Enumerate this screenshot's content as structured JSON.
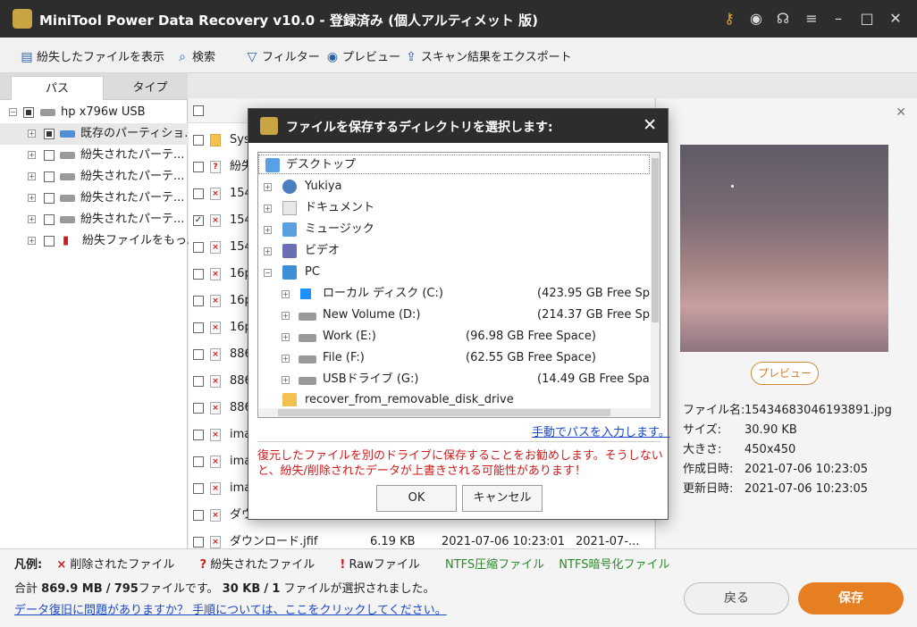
{
  "window": {
    "title": "MiniTool Power Data Recovery v10.0 - 登録済み (個人アルティメット 版)"
  },
  "toolbar": {
    "show_lost": "紛失したファイルを表示",
    "search": "検索",
    "filter": "フィルター",
    "preview": "プレビュー",
    "export": "スキャン結果をエクスポート"
  },
  "tabs": {
    "path": "パス",
    "type": "タイプ"
  },
  "tree": {
    "root": "hp x796w USB",
    "items": [
      "既存のパーティショ...",
      "紛失されたパーテ...",
      "紛失されたパーテ...",
      "紛失されたパーテ...",
      "紛失されたパーテ...",
      "紛失ファイルをもっ..."
    ]
  },
  "files": [
    {
      "name": "Sys",
      "icon": "folder"
    },
    {
      "name": "紛失",
      "icon": "lost"
    },
    {
      "name": "154",
      "icon": "deleted"
    },
    {
      "name": "154",
      "icon": "deleted"
    },
    {
      "name": "154",
      "icon": "deleted"
    },
    {
      "name": "16p",
      "icon": "deleted"
    },
    {
      "name": "16p",
      "icon": "deleted"
    },
    {
      "name": "16p",
      "icon": "deleted"
    },
    {
      "name": "886",
      "icon": "deleted"
    },
    {
      "name": "886",
      "icon": "deleted"
    },
    {
      "name": "886",
      "icon": "deleted"
    },
    {
      "name": "ima",
      "icon": "deleted"
    },
    {
      "name": "ima",
      "icon": "deleted"
    },
    {
      "name": "ima",
      "icon": "deleted"
    },
    {
      "name": "ダウン",
      "icon": "deleted"
    },
    {
      "name": "ダウンロード.jfif",
      "icon": "deleted",
      "size": "6.19 KB",
      "created": "2021-07-06 10:23:01",
      "modified": "2021-07-..."
    }
  ],
  "preview": {
    "button": "プレビュー",
    "filename_label": "ファイル名:",
    "filename": "15434683046193891.jpg",
    "size_label": "サイズ:",
    "size": "30.90 KB",
    "dims_label": "大きさ:",
    "dims": "450x450",
    "created_label": "作成日時:",
    "created": "2021-07-06 10:23:05",
    "modified_label": "更新日時:",
    "modified": "2021-07-06 10:23:05"
  },
  "legend": {
    "title": "凡例:",
    "deleted": "削除されたファイル",
    "lost": "紛失されたファイル",
    "raw": "Rawファイル",
    "ntfs_compressed": "NTFS圧縮ファイル",
    "ntfs_encrypted": "NTFS暗号化ファイル",
    "deleted_mark": "×",
    "lost_mark": "?",
    "raw_mark": "!"
  },
  "summary": {
    "prefix": "合計",
    "total_size": "869.9 MB",
    "sep1": "/",
    "total_files": "795",
    "mid": "ファイルです。",
    "sel_size": "30 KB",
    "sep2": "/",
    "sel_files": "1",
    "suffix": "ファイルが選択されました。"
  },
  "help_link": "データ復旧に問題がありますか？ 手順については、ここをクリックしてください。",
  "buttons": {
    "back": "戻る",
    "save": "保存"
  },
  "dialog": {
    "title": "ファイルを保存するディレクトリを選択します:",
    "nodes": {
      "desktop": "デスクトップ",
      "yukiya": "Yukiya",
      "documents": "ドキュメント",
      "music": "ミュージック",
      "video": "ビデオ",
      "pc": "PC",
      "local_c": "ローカル ディスク (C:)",
      "local_c_free": "(423.95 GB Free Sp",
      "vol_d": "New Volume (D:)",
      "vol_d_free": "(214.37 GB Free Sp",
      "work_e": "Work (E:)",
      "work_e_free": "(96.98 GB Free Space)",
      "file_f": "File (F:)",
      "file_f_free": "(62.55 GB Free Space)",
      "usb_g": "USBドライブ (G:)",
      "usb_g_free": "(14.49 GB Free Spa",
      "recover": "recover_from_removable_disk_drive"
    },
    "manual_link": "手動でパスを入力します。",
    "warning": "復元したファイルを別のドライブに保存することをお勧めします。そうしないと、紛失/削除されたデータが上書きされる可能性があります！",
    "ok": "OK",
    "cancel": "キャンセル"
  }
}
